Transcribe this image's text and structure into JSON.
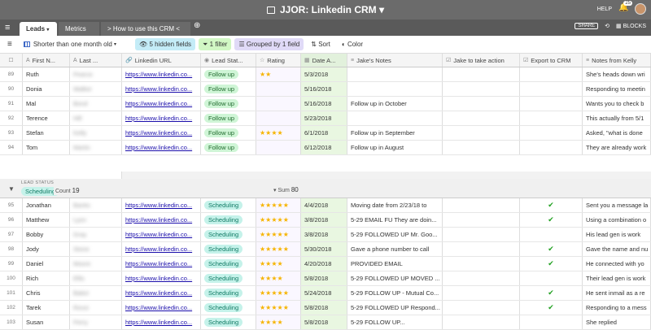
{
  "app": {
    "title": "JJOR: Linkedin CRM",
    "help": "HELP",
    "notifications": "25",
    "share": "SHARE",
    "blocks": "BLOCKS"
  },
  "tabs": [
    {
      "label": "Leads"
    },
    {
      "label": "Metrics"
    },
    {
      "label": "> How to use this CRM <"
    }
  ],
  "toolbar": {
    "view_name": "Shorter than one month old",
    "hidden_fields": "5 hidden fields",
    "filter": "1 filter",
    "grouped": "Grouped by 1 field",
    "sort": "Sort",
    "color": "Color"
  },
  "columns": [
    "First N...",
    "Last ...",
    "Linkedin URL",
    "Lead Stat...",
    "Rating",
    "Date A...",
    "Jake's Notes",
    "Jake to take action",
    "Export to CRM",
    "Notes from Kelly"
  ],
  "group1_rows": [
    {
      "num": "89",
      "first": "Ruth",
      "last": "Pearce",
      "url": "https://www.linkedin.co...",
      "status": "Follow up",
      "rating": 2,
      "date": "5/3/2018",
      "notes": "",
      "action": false,
      "export": false,
      "kelly": "She's heads down wri"
    },
    {
      "num": "90",
      "first": "Donia",
      "last": "Walker",
      "url": "https://www.linkedin.co...",
      "status": "Follow up",
      "rating": 0,
      "date": "5/16/2018",
      "notes": "",
      "action": false,
      "export": false,
      "kelly": "Responding to meetin"
    },
    {
      "num": "91",
      "first": "Mal",
      "last": "Bond",
      "url": "https://www.linkedin.co...",
      "status": "Follow up",
      "rating": 0,
      "date": "5/16/2018",
      "notes": "Follow up in October",
      "action": false,
      "export": false,
      "kelly": "Wants you to check b"
    },
    {
      "num": "92",
      "first": "Terence",
      "last": "Hill",
      "url": "https://www.linkedin.co...",
      "status": "Follow up",
      "rating": 0,
      "date": "5/23/2018",
      "notes": "",
      "action": false,
      "export": false,
      "kelly": "This actually from 5/1"
    },
    {
      "num": "93",
      "first": "Stefan",
      "last": "Kelly",
      "url": "https://www.linkedin.co...",
      "status": "Follow up",
      "rating": 4,
      "date": "6/1/2018",
      "notes": "Follow up in September",
      "action": false,
      "export": false,
      "kelly": "Asked, \"what is done"
    },
    {
      "num": "94",
      "first": "Tom",
      "last": "Martin",
      "url": "https://www.linkedin.co...",
      "status": "Follow up",
      "rating": 0,
      "date": "6/12/2018",
      "notes": "Follow up in August",
      "action": false,
      "export": false,
      "kelly": "They are already work"
    }
  ],
  "group2": {
    "label": "LEAD STATUS",
    "value": "Scheduling",
    "count_label": "Count",
    "count": "19",
    "sum_label": "Sum",
    "sum": "80"
  },
  "group2_rows": [
    {
      "num": "95",
      "first": "Jonathan",
      "last": "Banks",
      "url": "https://www.linkedin.co...",
      "status": "Scheduling",
      "rating": 5,
      "date": "4/4/2018",
      "notes": "Moving date from 2/23/18 to",
      "action": false,
      "export": true,
      "kelly": "Sent you a message la"
    },
    {
      "num": "96",
      "first": "Matthew",
      "last": "Lyon",
      "url": "https://www.linkedin.co...",
      "status": "Scheduling",
      "rating": 5,
      "date": "3/8/2018",
      "notes": "5-29 EMAIL FU They are doin...",
      "action": false,
      "export": true,
      "kelly": "Using a combination o"
    },
    {
      "num": "97",
      "first": "Bobby",
      "last": "Gray",
      "url": "https://www.linkedin.co...",
      "status": "Scheduling",
      "rating": 5,
      "date": "3/8/2018",
      "notes": "5-29 FOLLOWED UP Mr. Goo...",
      "action": false,
      "export": false,
      "kelly": "His lead gen is work"
    },
    {
      "num": "98",
      "first": "Jody",
      "last": "Stone",
      "url": "https://www.linkedin.co...",
      "status": "Scheduling",
      "rating": 5,
      "date": "5/30/2018",
      "notes": "Gave a phone number to call",
      "action": false,
      "export": true,
      "kelly": "Gave the name and nu"
    },
    {
      "num": "99",
      "first": "Daniel",
      "last": "Moore",
      "url": "https://www.linkedin.co...",
      "status": "Scheduling",
      "rating": 4,
      "date": "4/20/2018",
      "notes": "PROVIDED EMAIL",
      "action": false,
      "export": true,
      "kelly": "He connected with yo"
    },
    {
      "num": "100",
      "first": "Rich",
      "last": "Ellis",
      "url": "https://www.linkedin.co...",
      "status": "Scheduling",
      "rating": 4,
      "date": "5/8/2018",
      "notes": "5-29 FOLLOWED UP MOVED ...",
      "action": false,
      "export": false,
      "kelly": "Their lead gen is work"
    },
    {
      "num": "101",
      "first": "Chris",
      "last": "Baker",
      "url": "https://www.linkedin.co...",
      "status": "Scheduling",
      "rating": 5,
      "date": "5/24/2018",
      "notes": "5-29 FOLLOW UP - Mutual Co...",
      "action": false,
      "export": true,
      "kelly": "He sent inmail as a re"
    },
    {
      "num": "102",
      "first": "Tarek",
      "last": "Rossi",
      "url": "https://www.linkedin.co...",
      "status": "Scheduling",
      "rating": 5,
      "date": "5/8/2018",
      "notes": "5-29 FOLLOWED UP Respond...",
      "action": false,
      "export": true,
      "kelly": "Responding to a mess"
    },
    {
      "num": "103",
      "first": "Susan",
      "last": "Perry",
      "url": "https://www.linkedin.co...",
      "status": "Scheduling",
      "rating": 4,
      "date": "5/8/2018",
      "notes": "5-29 FOLLOW UP...",
      "action": false,
      "export": false,
      "kelly": "She replied"
    }
  ],
  "colors": {
    "follow_up": "#cff5d6",
    "scheduling": "#c5f2ea",
    "star": "#f6b400",
    "check": "#20a020"
  }
}
